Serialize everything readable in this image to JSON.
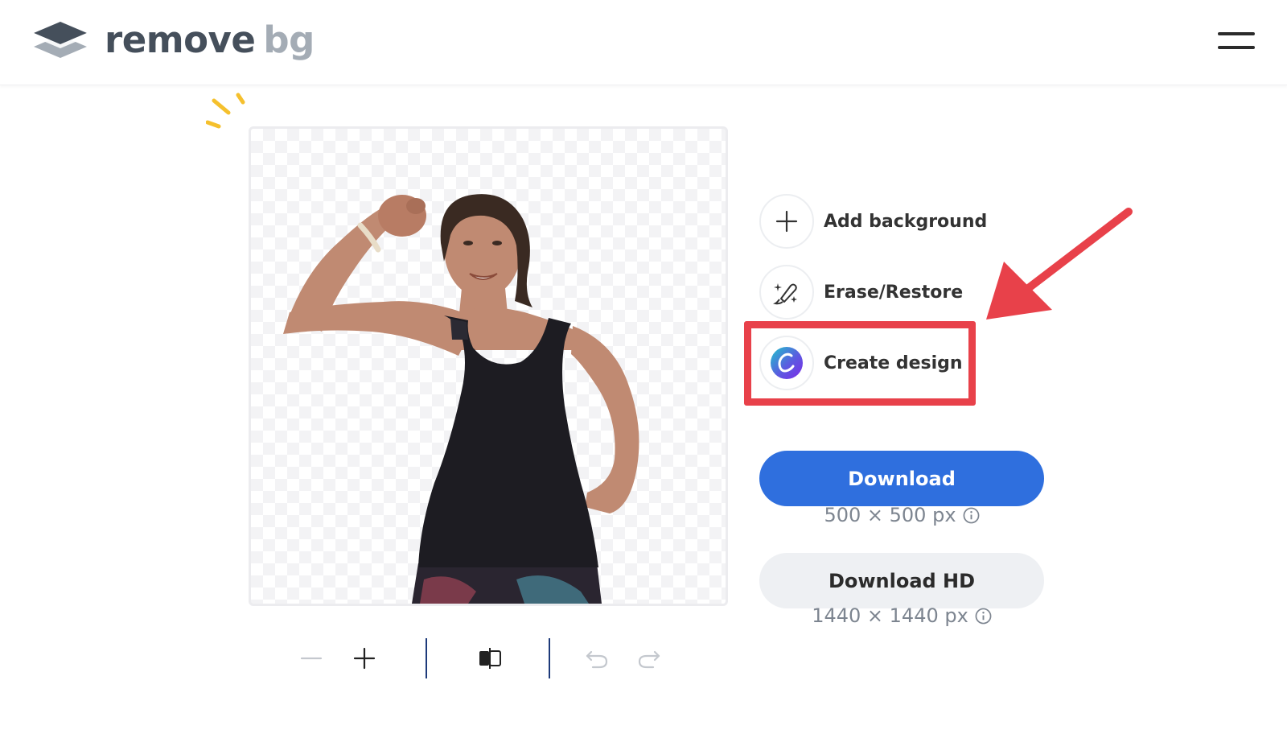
{
  "header": {
    "logo": {
      "word1": "remove",
      "word2": "bg",
      "icon": "layers-logo-icon"
    },
    "menu_icon": "hamburger-menu-icon"
  },
  "preview": {
    "subject": "cutout-person-image",
    "background": "transparent-checkerboard"
  },
  "actions": [
    {
      "label": "Add background",
      "icon": "plus-icon"
    },
    {
      "label": "Erase/Restore",
      "icon": "magic-brush-icon"
    },
    {
      "label": "Create design",
      "icon": "canva-logo-icon",
      "highlighted": true
    }
  ],
  "download": {
    "label": "Download",
    "size": "500 × 500 px",
    "color": "#2f6fde"
  },
  "download_hd": {
    "label": "Download HD",
    "size": "1440 × 1440 px"
  },
  "toolbar": {
    "items": [
      "zoom-out-icon",
      "zoom-in-icon",
      "compare-icon",
      "undo-icon",
      "redo-icon"
    ]
  },
  "colors": {
    "highlight": "#e8414a",
    "sparkle": "#f5c02d"
  }
}
